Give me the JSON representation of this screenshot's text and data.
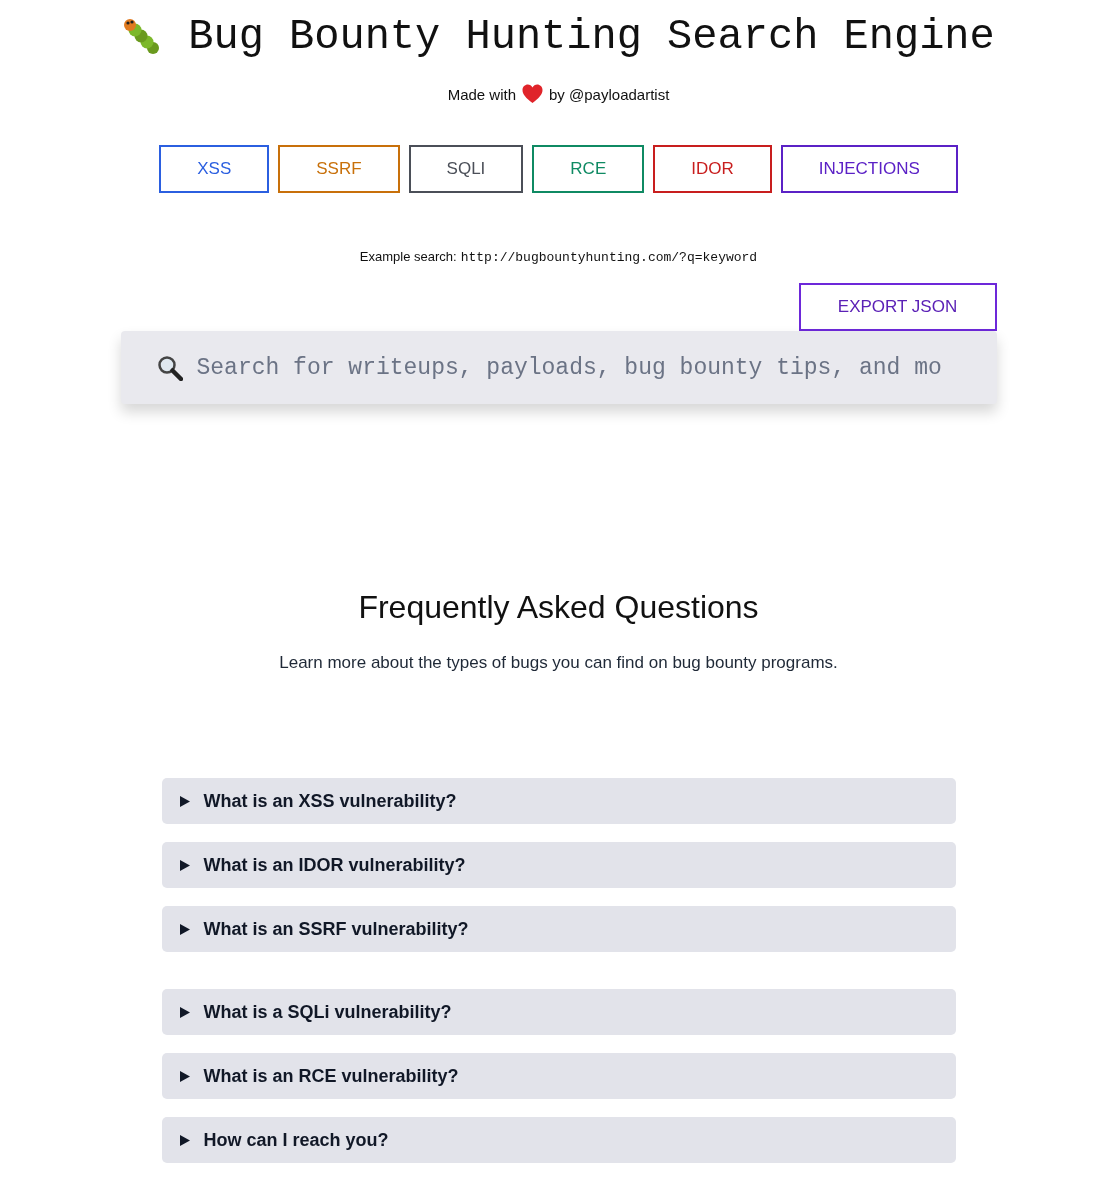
{
  "header": {
    "title": "Bug Bounty Hunting Search Engine",
    "credit": {
      "prefix": "Made with",
      "suffix": "by @payloadartist"
    }
  },
  "categories": [
    {
      "label": "XSS",
      "color": "#2b5fe0"
    },
    {
      "label": "SSRF",
      "color": "#c8700a"
    },
    {
      "label": "SQLI",
      "color": "#4b4f58"
    },
    {
      "label": "RCE",
      "color": "#0f8a63"
    },
    {
      "label": "IDOR",
      "color": "#c81e1e"
    },
    {
      "label": "INJECTIONS",
      "color": "#5b21c6"
    }
  ],
  "example": {
    "label": "Example search:",
    "url": "http://bugbountyhunting.com/?q=keyword"
  },
  "export_button": "EXPORT JSON",
  "search": {
    "placeholder": "Search for writeups, payloads, bug bounty tips, and mo"
  },
  "faq": {
    "title": "Frequently Asked Questions",
    "subtitle": "Learn more about the types of bugs you can find on bug bounty programs.",
    "items": [
      {
        "question": "What is an XSS vulnerability?",
        "expanded": false
      },
      {
        "question": "What is an IDOR vulnerability?",
        "expanded": false
      },
      {
        "question": "What is an SSRF vulnerability?",
        "expanded": false
      },
      {
        "question": "What is a SQLi vulnerability?",
        "expanded": false
      },
      {
        "question": "What is an RCE vulnerability?",
        "expanded": false
      },
      {
        "question": "How can I reach you?",
        "expanded": false
      }
    ]
  }
}
